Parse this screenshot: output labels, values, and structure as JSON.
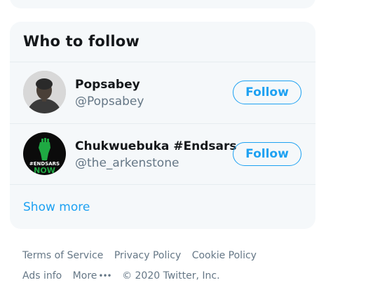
{
  "who_to_follow": {
    "title": "Who to follow",
    "users": [
      {
        "name": "Popsabey",
        "handle": "@Popsabey",
        "follow_label": "Follow"
      },
      {
        "name": "Chukwuebuka #Endsars",
        "handle": "@the_arkenstone",
        "follow_label": "Follow",
        "avatar_text_1": "#ENDSARS",
        "avatar_text_2": "NOW"
      }
    ],
    "show_more": "Show more"
  },
  "footer": {
    "links": [
      "Terms of Service",
      "Privacy Policy",
      "Cookie Policy",
      "Ads info"
    ],
    "more_label": "More",
    "more_icon": "ellipsis-icon",
    "copyright": "© 2020 Twitter, Inc."
  },
  "colors": {
    "accent": "#1da1f2",
    "card_bg": "#f5f8fa",
    "secondary_text": "#657786",
    "primary_text": "#14171a",
    "endsars_green": "#1fa943"
  }
}
